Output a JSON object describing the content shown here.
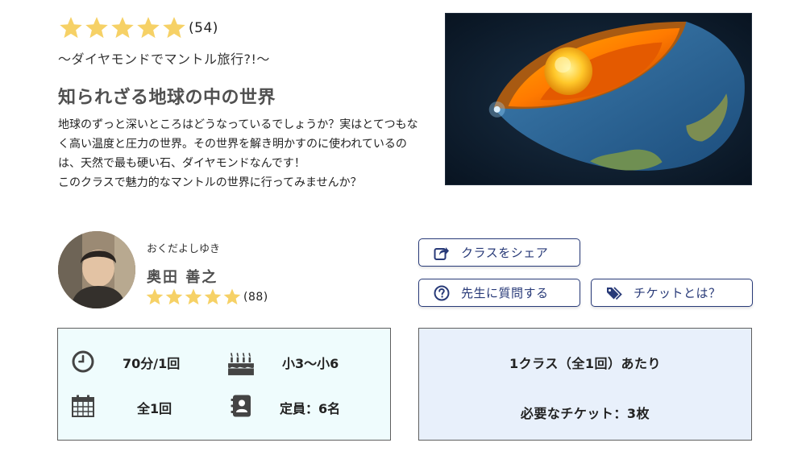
{
  "course": {
    "rating_stars": 5,
    "rating_count": "(54)",
    "subtitle": "〜ダイヤモンドでマントル旅行?!〜",
    "title": "知られざる地球の中の世界",
    "description": [
      "地球のずっと深いところはどうなっているでしょうか？実はとてつもなく高い温度と圧力の世界。その世界を解き明かすのに使われているのは、天然で最も硬い石、ダイヤモンドなんです！",
      "このクラスで魅力的なマントルの世界に行ってみませんか？"
    ],
    "image_icon": "earth-cross-section"
  },
  "teacher": {
    "kana": "おくだよしゆき",
    "name": "奥田 善之",
    "rating_stars": 5,
    "rating_count": "(88)"
  },
  "buttons": {
    "share": "クラスをシェア",
    "ask": "先生に質問する",
    "ticket": "チケットとは？"
  },
  "info": {
    "duration": "70分/1回",
    "grade": "小3〜小6",
    "sessions": "全1回",
    "capacity": "定員：6名"
  },
  "price": {
    "per_class": "1クラス（全1回）あたり",
    "tickets": "必要なチケット：3枚"
  },
  "colors": {
    "star": "#f6d166",
    "button_border": "#283a78",
    "info_bg": "#effcfd",
    "price_bg": "#e8f0fb"
  }
}
